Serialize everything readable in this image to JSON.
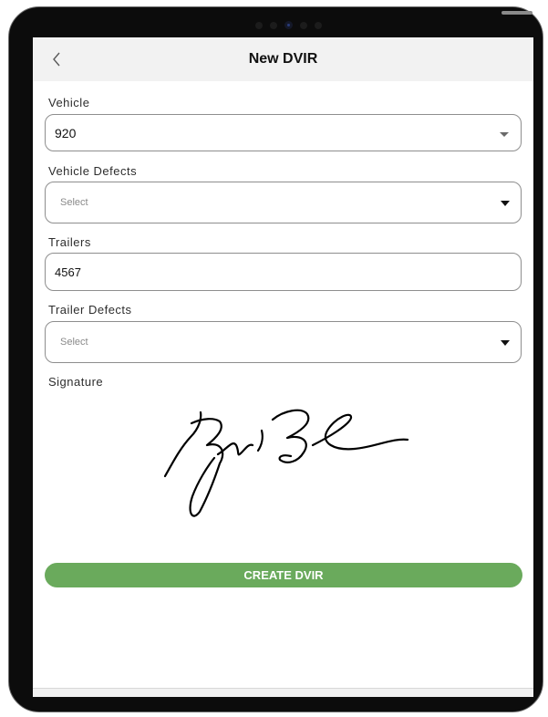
{
  "header": {
    "back_icon": "chevron-left-icon",
    "title": "New DVIR"
  },
  "form": {
    "vehicle": {
      "label": "Vehicle",
      "value": "920"
    },
    "vehicle_defects": {
      "label": "Vehicle Defects",
      "placeholder": "Select"
    },
    "trailers": {
      "label": "Trailers",
      "value": "4567"
    },
    "trailer_defects": {
      "label": "Trailer Defects",
      "placeholder": "Select"
    },
    "signature": {
      "label": "Signature"
    }
  },
  "actions": {
    "create_label": "CREATE DVIR"
  },
  "colors": {
    "accent_button": "#6aaa5c",
    "header_bg": "#f2f2f2",
    "field_border": "#8e8e8e"
  }
}
